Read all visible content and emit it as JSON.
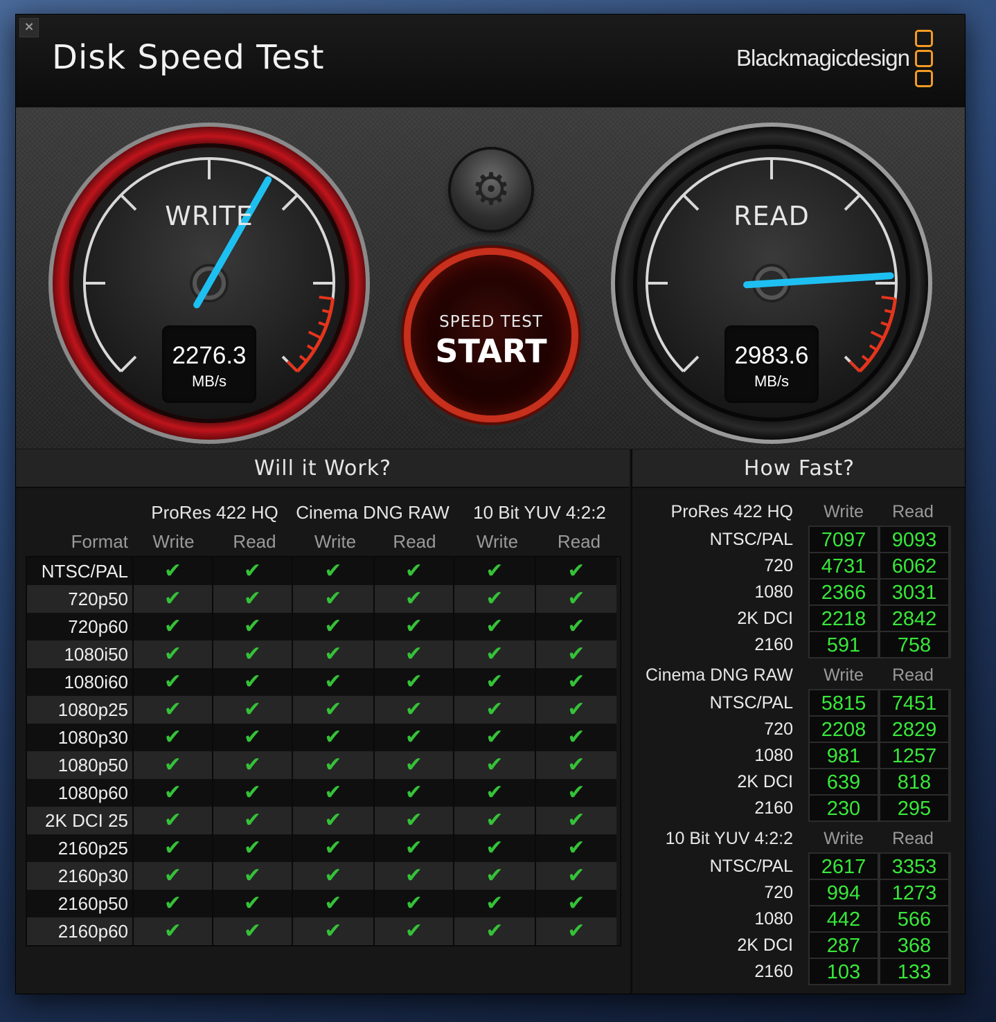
{
  "window": {
    "title": "Disk Speed Test",
    "close_icon": "close-icon",
    "brand": "Blackmagicdesign"
  },
  "colors": {
    "needle": "#1ec0f2",
    "write_rim": "#b3131b",
    "check": "#35c238",
    "speed_value": "#38e83a",
    "logo": "#f29b26"
  },
  "gauges": {
    "write": {
      "label": "WRITE",
      "value": "2276.3",
      "unit": "MB/s",
      "needle_fraction": 0.61
    },
    "read": {
      "label": "READ",
      "value": "2983.6",
      "unit": "MB/s",
      "needle_fraction": 0.82
    }
  },
  "settings_button": {
    "icon": "gear-icon"
  },
  "start_button": {
    "small_label": "SPEED TEST",
    "big_label": "START"
  },
  "will_it_work": {
    "title": "Will it Work?",
    "format_label": "Format",
    "groups": [
      "ProRes 422 HQ",
      "Cinema DNG RAW",
      "10 Bit YUV 4:2:2"
    ],
    "columns": [
      "Write",
      "Read",
      "Write",
      "Read",
      "Write",
      "Read"
    ],
    "check_glyph": "✔",
    "rows": [
      {
        "format": "NTSC/PAL",
        "checks": [
          true,
          true,
          true,
          true,
          true,
          true
        ]
      },
      {
        "format": "720p50",
        "checks": [
          true,
          true,
          true,
          true,
          true,
          true
        ]
      },
      {
        "format": "720p60",
        "checks": [
          true,
          true,
          true,
          true,
          true,
          true
        ]
      },
      {
        "format": "1080i50",
        "checks": [
          true,
          true,
          true,
          true,
          true,
          true
        ]
      },
      {
        "format": "1080i60",
        "checks": [
          true,
          true,
          true,
          true,
          true,
          true
        ]
      },
      {
        "format": "1080p25",
        "checks": [
          true,
          true,
          true,
          true,
          true,
          true
        ]
      },
      {
        "format": "1080p30",
        "checks": [
          true,
          true,
          true,
          true,
          true,
          true
        ]
      },
      {
        "format": "1080p50",
        "checks": [
          true,
          true,
          true,
          true,
          true,
          true
        ]
      },
      {
        "format": "1080p60",
        "checks": [
          true,
          true,
          true,
          true,
          true,
          true
        ]
      },
      {
        "format": "2K DCI 25",
        "checks": [
          true,
          true,
          true,
          true,
          true,
          true
        ]
      },
      {
        "format": "2160p25",
        "checks": [
          true,
          true,
          true,
          true,
          true,
          true
        ]
      },
      {
        "format": "2160p30",
        "checks": [
          true,
          true,
          true,
          true,
          true,
          true
        ]
      },
      {
        "format": "2160p50",
        "checks": [
          true,
          true,
          true,
          true,
          true,
          true
        ]
      },
      {
        "format": "2160p60",
        "checks": [
          true,
          true,
          true,
          true,
          true,
          true
        ]
      }
    ]
  },
  "how_fast": {
    "title": "How Fast?",
    "blocks": [
      {
        "name": "ProRes 422 HQ",
        "write_label": "Write",
        "read_label": "Read",
        "rows": [
          {
            "label": "NTSC/PAL",
            "write": "7097",
            "read": "9093"
          },
          {
            "label": "720",
            "write": "4731",
            "read": "6062"
          },
          {
            "label": "1080",
            "write": "2366",
            "read": "3031"
          },
          {
            "label": "2K DCI",
            "write": "2218",
            "read": "2842"
          },
          {
            "label": "2160",
            "write": "591",
            "read": "758"
          }
        ]
      },
      {
        "name": "Cinema DNG RAW",
        "write_label": "Write",
        "read_label": "Read",
        "rows": [
          {
            "label": "NTSC/PAL",
            "write": "5815",
            "read": "7451"
          },
          {
            "label": "720",
            "write": "2208",
            "read": "2829"
          },
          {
            "label": "1080",
            "write": "981",
            "read": "1257"
          },
          {
            "label": "2K DCI",
            "write": "639",
            "read": "818"
          },
          {
            "label": "2160",
            "write": "230",
            "read": "295"
          }
        ]
      },
      {
        "name": "10 Bit YUV 4:2:2",
        "write_label": "Write",
        "read_label": "Read",
        "rows": [
          {
            "label": "NTSC/PAL",
            "write": "2617",
            "read": "3353"
          },
          {
            "label": "720",
            "write": "994",
            "read": "1273"
          },
          {
            "label": "1080",
            "write": "442",
            "read": "566"
          },
          {
            "label": "2K DCI",
            "write": "287",
            "read": "368"
          },
          {
            "label": "2160",
            "write": "103",
            "read": "133"
          }
        ]
      }
    ]
  }
}
